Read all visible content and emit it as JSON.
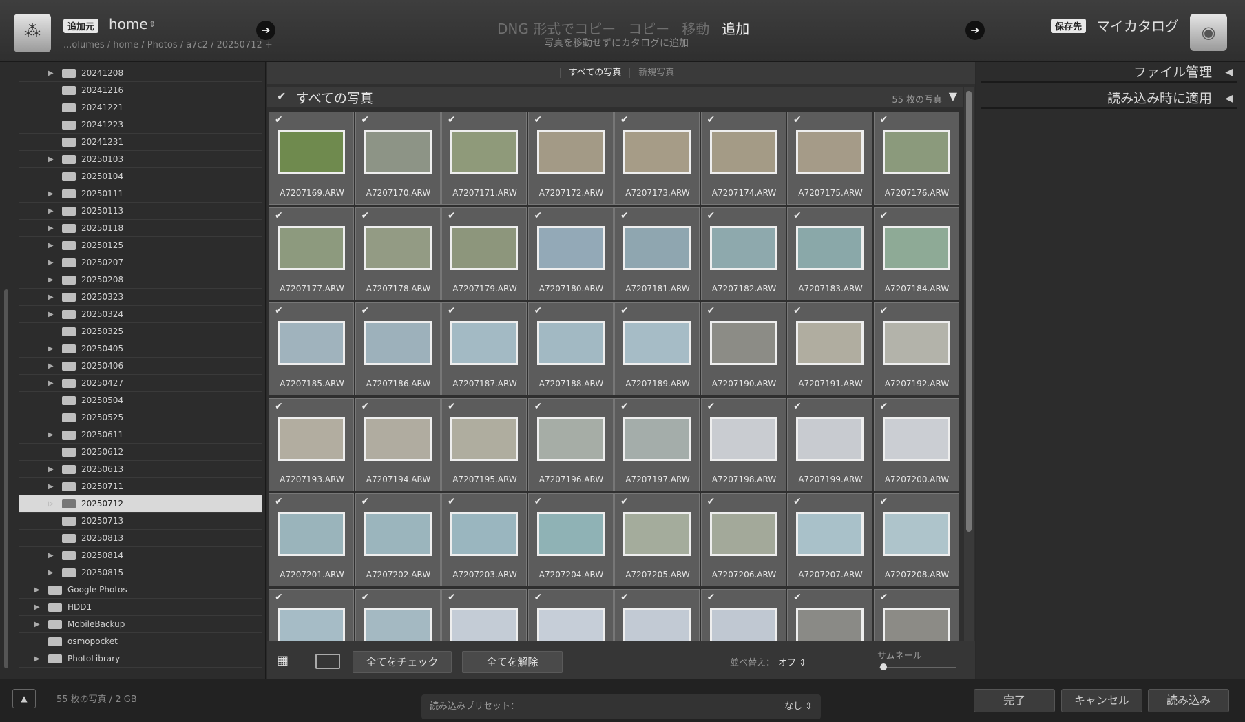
{
  "header": {
    "source_badge": "追加元",
    "source_name": "home",
    "source_caret": "⇕",
    "source_path": "...olumes / home / Photos / a7c2 / 20250712 +",
    "modes": [
      {
        "label": "DNG 形式でコピー",
        "active": false
      },
      {
        "label": "コピー",
        "active": false
      },
      {
        "label": "移動",
        "active": false
      },
      {
        "label": "追加",
        "active": true
      }
    ],
    "mode_description": "写真を移動せずにカタログに追加",
    "destination_badge": "保存先",
    "destination_name": "マイカタログ"
  },
  "folders": [
    {
      "name": "20241208",
      "expandable": true,
      "level": 1
    },
    {
      "name": "20241216",
      "expandable": false,
      "level": 1
    },
    {
      "name": "20241221",
      "expandable": false,
      "level": 1
    },
    {
      "name": "20241223",
      "expandable": false,
      "level": 1
    },
    {
      "name": "20241231",
      "expandable": false,
      "level": 1
    },
    {
      "name": "20250103",
      "expandable": true,
      "level": 1
    },
    {
      "name": "20250104",
      "expandable": false,
      "level": 1
    },
    {
      "name": "20250111",
      "expandable": true,
      "level": 1
    },
    {
      "name": "20250113",
      "expandable": true,
      "level": 1
    },
    {
      "name": "20250118",
      "expandable": true,
      "level": 1
    },
    {
      "name": "20250125",
      "expandable": true,
      "level": 1
    },
    {
      "name": "20250207",
      "expandable": true,
      "level": 1
    },
    {
      "name": "20250208",
      "expandable": true,
      "level": 1
    },
    {
      "name": "20250323",
      "expandable": true,
      "level": 1
    },
    {
      "name": "20250324",
      "expandable": true,
      "level": 1
    },
    {
      "name": "20250325",
      "expandable": false,
      "level": 1
    },
    {
      "name": "20250405",
      "expandable": true,
      "level": 1
    },
    {
      "name": "20250406",
      "expandable": true,
      "level": 1
    },
    {
      "name": "20250427",
      "expandable": true,
      "level": 1
    },
    {
      "name": "20250504",
      "expandable": false,
      "level": 1
    },
    {
      "name": "20250525",
      "expandable": false,
      "level": 1
    },
    {
      "name": "20250611",
      "expandable": true,
      "level": 1
    },
    {
      "name": "20250612",
      "expandable": false,
      "level": 1
    },
    {
      "name": "20250613",
      "expandable": true,
      "level": 1
    },
    {
      "name": "20250711",
      "expandable": true,
      "level": 1
    },
    {
      "name": "20250712",
      "expandable": true,
      "level": 1,
      "selected": true
    },
    {
      "name": "20250713",
      "expandable": false,
      "level": 1
    },
    {
      "name": "20250813",
      "expandable": false,
      "level": 1
    },
    {
      "name": "20250814",
      "expandable": true,
      "level": 1
    },
    {
      "name": "20250815",
      "expandable": true,
      "level": 1
    },
    {
      "name": "Google Photos",
      "expandable": true,
      "level": 0
    },
    {
      "name": "HDD1",
      "expandable": true,
      "level": 0
    },
    {
      "name": "MobileBackup",
      "expandable": true,
      "level": 0
    },
    {
      "name": "osmopocket",
      "expandable": false,
      "level": 0
    },
    {
      "name": "PhotoLibrary",
      "expandable": true,
      "level": 0
    }
  ],
  "filter_tabs": [
    {
      "label": "すべての写真",
      "active": true
    },
    {
      "label": "新規写真",
      "active": false
    }
  ],
  "grid": {
    "check": "✔",
    "title": "すべての写真",
    "count": "55 枚の写真",
    "collapse_glyph": "▼",
    "photos": [
      {
        "name": "A7207169.ARW",
        "color": "#6f8a4e"
      },
      {
        "name": "A7207170.ARW",
        "color": "#8d9486"
      },
      {
        "name": "A7207171.ARW",
        "color": "#8f9a7a"
      },
      {
        "name": "A7207172.ARW",
        "color": "#a39a86"
      },
      {
        "name": "A7207173.ARW",
        "color": "#a69c87"
      },
      {
        "name": "A7207174.ARW",
        "color": "#a49b86"
      },
      {
        "name": "A7207175.ARW",
        "color": "#a59b88"
      },
      {
        "name": "A7207176.ARW",
        "color": "#8b9a7c"
      },
      {
        "name": "A7207177.ARW",
        "color": "#8d9a7e"
      },
      {
        "name": "A7207178.ARW",
        "color": "#939b84"
      },
      {
        "name": "A7207179.ARW",
        "color": "#8d967c"
      },
      {
        "name": "A7207180.ARW",
        "color": "#93a9b7"
      },
      {
        "name": "A7207181.ARW",
        "color": "#8fa6b0"
      },
      {
        "name": "A7207182.ARW",
        "color": "#8ea9ad"
      },
      {
        "name": "A7207183.ARW",
        "color": "#8aa8a9"
      },
      {
        "name": "A7207184.ARW",
        "color": "#8eaa96"
      },
      {
        "name": "A7207185.ARW",
        "color": "#a0b3bd"
      },
      {
        "name": "A7207186.ARW",
        "color": "#9db1bb"
      },
      {
        "name": "A7207187.ARW",
        "color": "#a3bac4"
      },
      {
        "name": "A7207188.ARW",
        "color": "#a2b9c3"
      },
      {
        "name": "A7207189.ARW",
        "color": "#a6bcc6"
      },
      {
        "name": "A7207190.ARW",
        "color": "#8c8c86"
      },
      {
        "name": "A7207191.ARW",
        "color": "#b0ada0"
      },
      {
        "name": "A7207192.ARW",
        "color": "#b3b3aa"
      },
      {
        "name": "A7207193.ARW",
        "color": "#b2ada0"
      },
      {
        "name": "A7207194.ARW",
        "color": "#b0aca0"
      },
      {
        "name": "A7207195.ARW",
        "color": "#afad9f"
      },
      {
        "name": "A7207196.ARW",
        "color": "#a6ada6"
      },
      {
        "name": "A7207197.ARW",
        "color": "#a4adaa"
      },
      {
        "name": "A7207198.ARW",
        "color": "#c9ccd1"
      },
      {
        "name": "A7207199.ARW",
        "color": "#c8cbd0"
      },
      {
        "name": "A7207200.ARW",
        "color": "#cbced3"
      },
      {
        "name": "A7207201.ARW",
        "color": "#9ab4bb"
      },
      {
        "name": "A7207202.ARW",
        "color": "#9bb5bd"
      },
      {
        "name": "A7207203.ARW",
        "color": "#9ab6bf"
      },
      {
        "name": "A7207204.ARW",
        "color": "#8fb2b5"
      },
      {
        "name": "A7207205.ARW",
        "color": "#a4ac9c"
      },
      {
        "name": "A7207206.ARW",
        "color": "#a3a99a"
      },
      {
        "name": "A7207207.ARW",
        "color": "#a9c1c9"
      },
      {
        "name": "A7207208.ARW",
        "color": "#aec4cb"
      },
      {
        "name": "",
        "color": "#a6bcc6"
      },
      {
        "name": "",
        "color": "#a4b9c2"
      },
      {
        "name": "",
        "color": "#c4ccd6"
      },
      {
        "name": "",
        "color": "#c6ced8"
      },
      {
        "name": "",
        "color": "#c2cad4"
      },
      {
        "name": "",
        "color": "#c0c8d2"
      },
      {
        "name": "",
        "color": "#8a8a86"
      },
      {
        "name": "",
        "color": "#8c8b86"
      }
    ]
  },
  "toolbar": {
    "grid_glyph": "▦",
    "check_all": "全てをチェック",
    "uncheck_all": "全てを解除",
    "sort_label": "並べ替え：",
    "sort_value": "オフ ⇕",
    "thumb_label": "サムネール"
  },
  "right_panel": {
    "file_management": "ファイル管理",
    "apply_on_import": "読み込み時に適用",
    "collapse_glyph": "◀"
  },
  "footer": {
    "collapse_glyph": "▲",
    "info": "55 枚の写真 / 2 GB",
    "preset_label": "読み込みプリセット：",
    "preset_value": "なし ⇕",
    "done": "完了",
    "cancel": "キャンセル",
    "import": "読み込み"
  }
}
